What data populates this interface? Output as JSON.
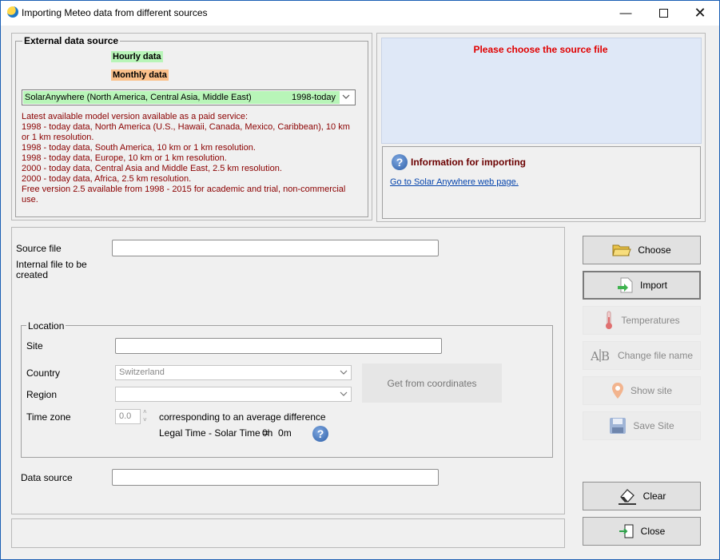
{
  "window": {
    "title": "Importing Meteo data from different sources"
  },
  "external": {
    "legend": "External data source",
    "hourly_label": "Hourly data",
    "monthly_label": "Monthly data",
    "source_selected": "SolarAnywhere (North America, Central Asia, Middle East)",
    "source_period": "1998-today",
    "info_lines": [
      "Latest available model version available as a paid service:",
      "1998 - today data, North America (U.S., Hawaii, Canada, Mexico, Caribbean), 10 km",
      "or 1 km resolution.",
      "1998 - today data, South America, 10 km or 1 km resolution.",
      "1998 - today data, Europe, 10 km or 1 km resolution.",
      "2000 - today data, Central Asia and Middle East, 2.5 km resolution.",
      "2000 - today data, Africa, 2.5 km resolution.",
      "Free version 2.5 available from 1998 - 2015 for academic and trial, non-commercial",
      "use."
    ]
  },
  "status": {
    "message": "Please choose the source file"
  },
  "import_info": {
    "title": "Information for importing",
    "link": "Go to Solar Anywhere web page."
  },
  "form": {
    "source_file_label": "Source file",
    "source_file_value": "",
    "internal_file_label": "Internal file to be created",
    "location_legend": "Location",
    "site_label": "Site",
    "site_value": "",
    "country_label": "Country",
    "country_value": "Switzerland",
    "region_label": "Region",
    "region_value": "",
    "timezone_label": "Time zone",
    "timezone_value": "0.0",
    "timezone_desc": "corresponding to an average difference",
    "legal_time_label": "Legal Time - Solar Time =",
    "legal_time_value": "0h  0m",
    "get_coords_label": "Get from coordinates",
    "data_source_label": "Data source",
    "data_source_value": ""
  },
  "buttons": {
    "choose": "Choose",
    "import": "Import",
    "temperatures": "Temperatures",
    "change_name": "Change file name",
    "show_site": "Show site",
    "save_site": "Save Site",
    "clear": "Clear",
    "close": "Close"
  },
  "colors": {
    "hourly_bg": "#b8f5b8",
    "monthly_bg": "#fbc08a",
    "status_red": "#e00000",
    "info_red": "#8b0000",
    "status_panel": "#dfe8f7"
  }
}
